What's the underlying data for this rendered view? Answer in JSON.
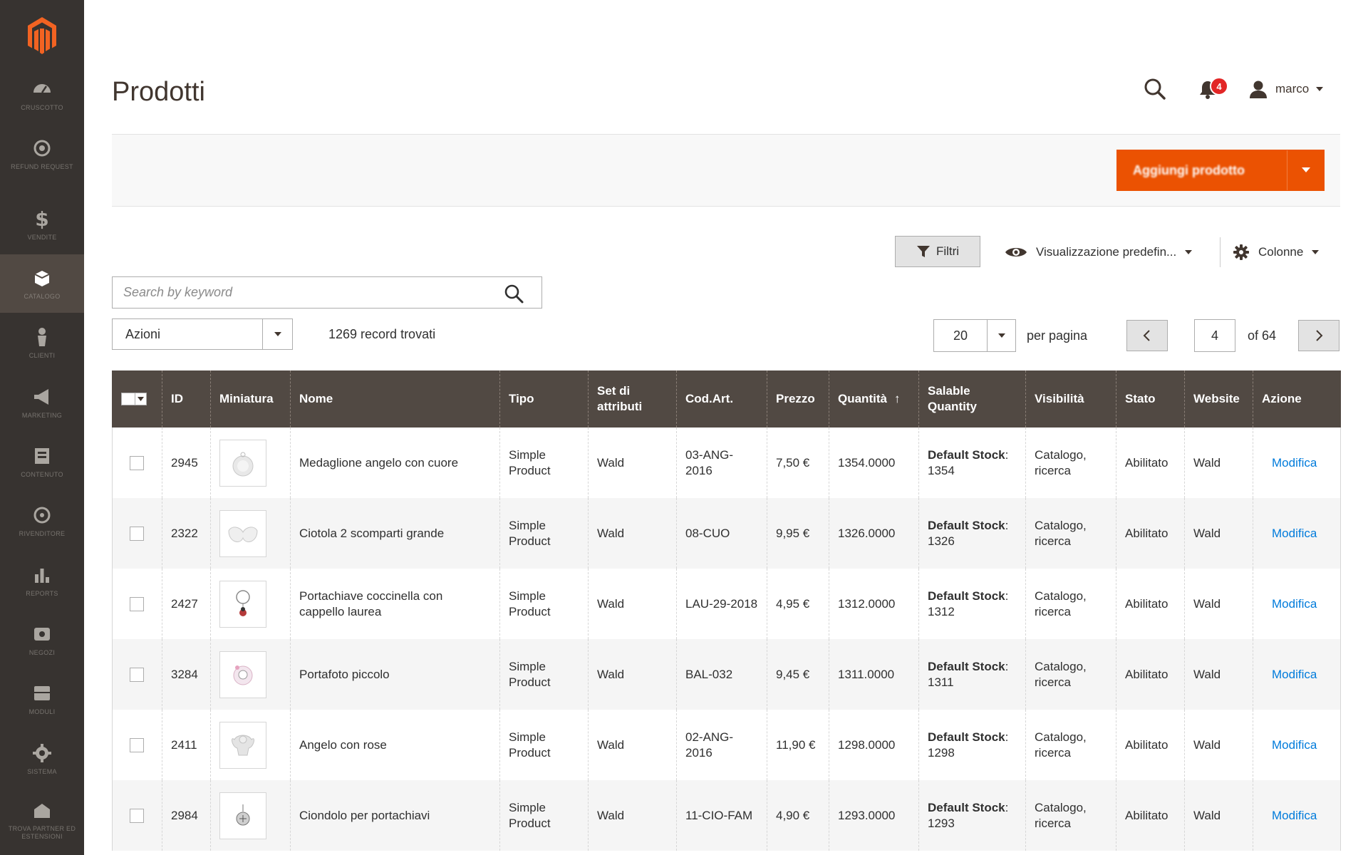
{
  "page": {
    "title": "Prodotti"
  },
  "header": {
    "notifications_count": "4",
    "user_name": "marco"
  },
  "sidebar": {
    "items": [
      {
        "label": "Cruscotto",
        "icon": "dashboard-icon"
      },
      {
        "label": "Refund Request",
        "icon": "refund-icon"
      },
      {
        "label": "Vendite",
        "icon": "dollar-icon"
      },
      {
        "label": "Catalogo",
        "icon": "catalog-icon",
        "active": true
      },
      {
        "label": "Clienti",
        "icon": "customer-icon"
      },
      {
        "label": "Marketing",
        "icon": "megaphone-icon"
      },
      {
        "label": "Contenuto",
        "icon": "content-icon"
      },
      {
        "label": "Rivenditore",
        "icon": "store-icon"
      },
      {
        "label": "Reports",
        "icon": "bar-chart-icon"
      },
      {
        "label": "Negozi",
        "icon": "stores-icon"
      },
      {
        "label": "Moduli",
        "icon": "modules-icon"
      },
      {
        "label": "Sistema",
        "icon": "gear-icon"
      },
      {
        "label": "Trova partner ed estensioni",
        "icon": "partner-icon"
      }
    ]
  },
  "toolbar": {
    "add_product_label": "Aggiungi prodotto",
    "filters_label": "Filtri",
    "view_label": "Visualizzazione predefin...",
    "columns_label": "Colonne",
    "search_placeholder": "Search by keyword",
    "actions_label": "Azioni",
    "records_found": "1269 record trovati",
    "per_page_value": "20",
    "per_page_label": "per pagina",
    "current_page": "4",
    "of_pages": "of 64"
  },
  "grid": {
    "columns": {
      "id": "ID",
      "thumbnail": "Miniatura",
      "name": "Nome",
      "type": "Tipo",
      "attribute_set": "Set di attributi",
      "sku": "Cod.Art.",
      "price": "Prezzo",
      "quantity": "Quantità",
      "salable": "Salable Quantity",
      "visibility": "Visibilità",
      "status": "Stato",
      "website": "Website",
      "action": "Azione"
    },
    "rows": [
      {
        "id": "2945",
        "name": "Medaglione angelo con cuore",
        "type": "Simple Product",
        "attribute_set": "Wald",
        "sku": "03-ANG-2016",
        "price": "7,50 €",
        "quantity": "1354.0000",
        "stock_label": "Default Stock",
        "stock_value": "1354",
        "visibility": "Catalogo, ricerca",
        "status": "Abilitato",
        "website": "Wald",
        "action": "Modifica",
        "thumb": "medallion"
      },
      {
        "id": "2322",
        "name": "Ciotola 2 scomparti grande",
        "type": "Simple Product",
        "attribute_set": "Wald",
        "sku": "08-CUO",
        "price": "9,95 €",
        "quantity": "1326.0000",
        "stock_label": "Default Stock",
        "stock_value": "1326",
        "visibility": "Catalogo, ricerca",
        "status": "Abilitato",
        "website": "Wald",
        "action": "Modifica",
        "thumb": "bowl"
      },
      {
        "id": "2427",
        "name": "Portachiave coccinella con cappello laurea",
        "type": "Simple Product",
        "attribute_set": "Wald",
        "sku": "LAU-29-2018",
        "price": "4,95 €",
        "quantity": "1312.0000",
        "stock_label": "Default Stock",
        "stock_value": "1312",
        "visibility": "Catalogo, ricerca",
        "status": "Abilitato",
        "website": "Wald",
        "action": "Modifica",
        "thumb": "keychain"
      },
      {
        "id": "3284",
        "name": "Portafoto piccolo",
        "type": "Simple Product",
        "attribute_set": "Wald",
        "sku": "BAL-032",
        "price": "9,45 €",
        "quantity": "1311.0000",
        "stock_label": "Default Stock",
        "stock_value": "1311",
        "visibility": "Catalogo, ricerca",
        "status": "Abilitato",
        "website": "Wald",
        "action": "Modifica",
        "thumb": "frame"
      },
      {
        "id": "2411",
        "name": "Angelo con rose",
        "type": "Simple Product",
        "attribute_set": "Wald",
        "sku": "02-ANG-2016",
        "price": "11,90 €",
        "quantity": "1298.0000",
        "stock_label": "Default Stock",
        "stock_value": "1298",
        "visibility": "Catalogo, ricerca",
        "status": "Abilitato",
        "website": "Wald",
        "action": "Modifica",
        "thumb": "angel"
      },
      {
        "id": "2984",
        "name": "Ciondolo per portachiavi",
        "type": "Simple Product",
        "attribute_set": "Wald",
        "sku": "11-CIO-FAM",
        "price": "4,90 €",
        "quantity": "1293.0000",
        "stock_label": "Default Stock",
        "stock_value": "1293",
        "visibility": "Catalogo, ricerca",
        "status": "Abilitato",
        "website": "Wald",
        "action": "Modifica",
        "thumb": "pendant"
      }
    ]
  },
  "colors": {
    "sidebar_bg": "#373330",
    "header_bg": "#514943",
    "accent": "#eb5202",
    "link": "#007bdb",
    "badge": "#e22626"
  }
}
